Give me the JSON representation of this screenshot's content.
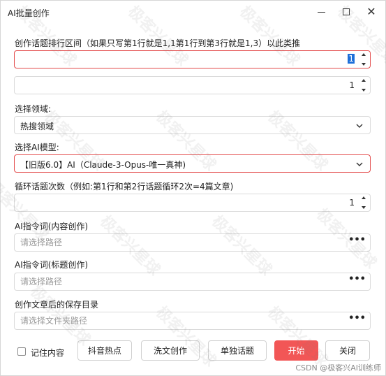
{
  "window": {
    "title": "AI批量创作"
  },
  "topic_range": {
    "label": "创作话题排行区间（如果只写第1行就是1,1第1行到第3行就是1,3）以此类推",
    "start_value": "1",
    "end_value": "1"
  },
  "domain": {
    "label": "选择领域:",
    "value": "热搜领域"
  },
  "model": {
    "label": "选择AI模型:",
    "value": "【旧版6.0】AI（Claude-3-Opus-唯一真神)"
  },
  "loop": {
    "label": "循环话题次数（例如:第1行和第2行话题循环2次=4篇文章)",
    "value": "1"
  },
  "content_prompt": {
    "label": "AI指令词(内容创作)",
    "placeholder": "请选择路径",
    "browse": "•••"
  },
  "title_prompt": {
    "label": "AI指令词(标题创作)",
    "placeholder": "请选择路径",
    "browse": "•••"
  },
  "save_dir": {
    "label": "创作文章后的保存目录",
    "placeholder": "请选择文件夹路径",
    "browse": "•••"
  },
  "footer": {
    "remember_label": "记住内容",
    "buttons": {
      "douyin": "抖音热点",
      "rewrite": "洗文创作",
      "single": "单独话题",
      "start": "开始",
      "close": "关闭"
    }
  },
  "watermark": "极客兴星球",
  "credit": "CSDN @极客兴AI训练师",
  "colors": {
    "accent": "#f25656",
    "error_border": "#e34a4a",
    "selection": "#1e6fd9"
  }
}
